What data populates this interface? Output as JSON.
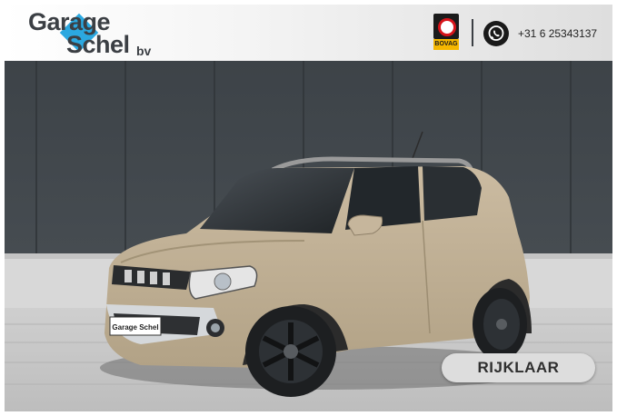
{
  "header": {
    "logo": {
      "line1": "Garage",
      "line2": "Schel",
      "suffix": "bv",
      "accent_color": "#2ba8e0"
    },
    "bovag": {
      "label": "BOVAG",
      "icon": "bovag-logo"
    },
    "whatsapp": {
      "icon": "whatsapp-icon",
      "phone": "+31 6 25343137"
    }
  },
  "main": {
    "photo": {
      "subject": "car-photo",
      "plate_text": "Garage Schel"
    },
    "badge": {
      "label": "RIJKLAAR"
    }
  },
  "colors": {
    "car_body": "#bfae93",
    "background_wall": "#3e4449",
    "badge_bg": "#dddddd"
  }
}
